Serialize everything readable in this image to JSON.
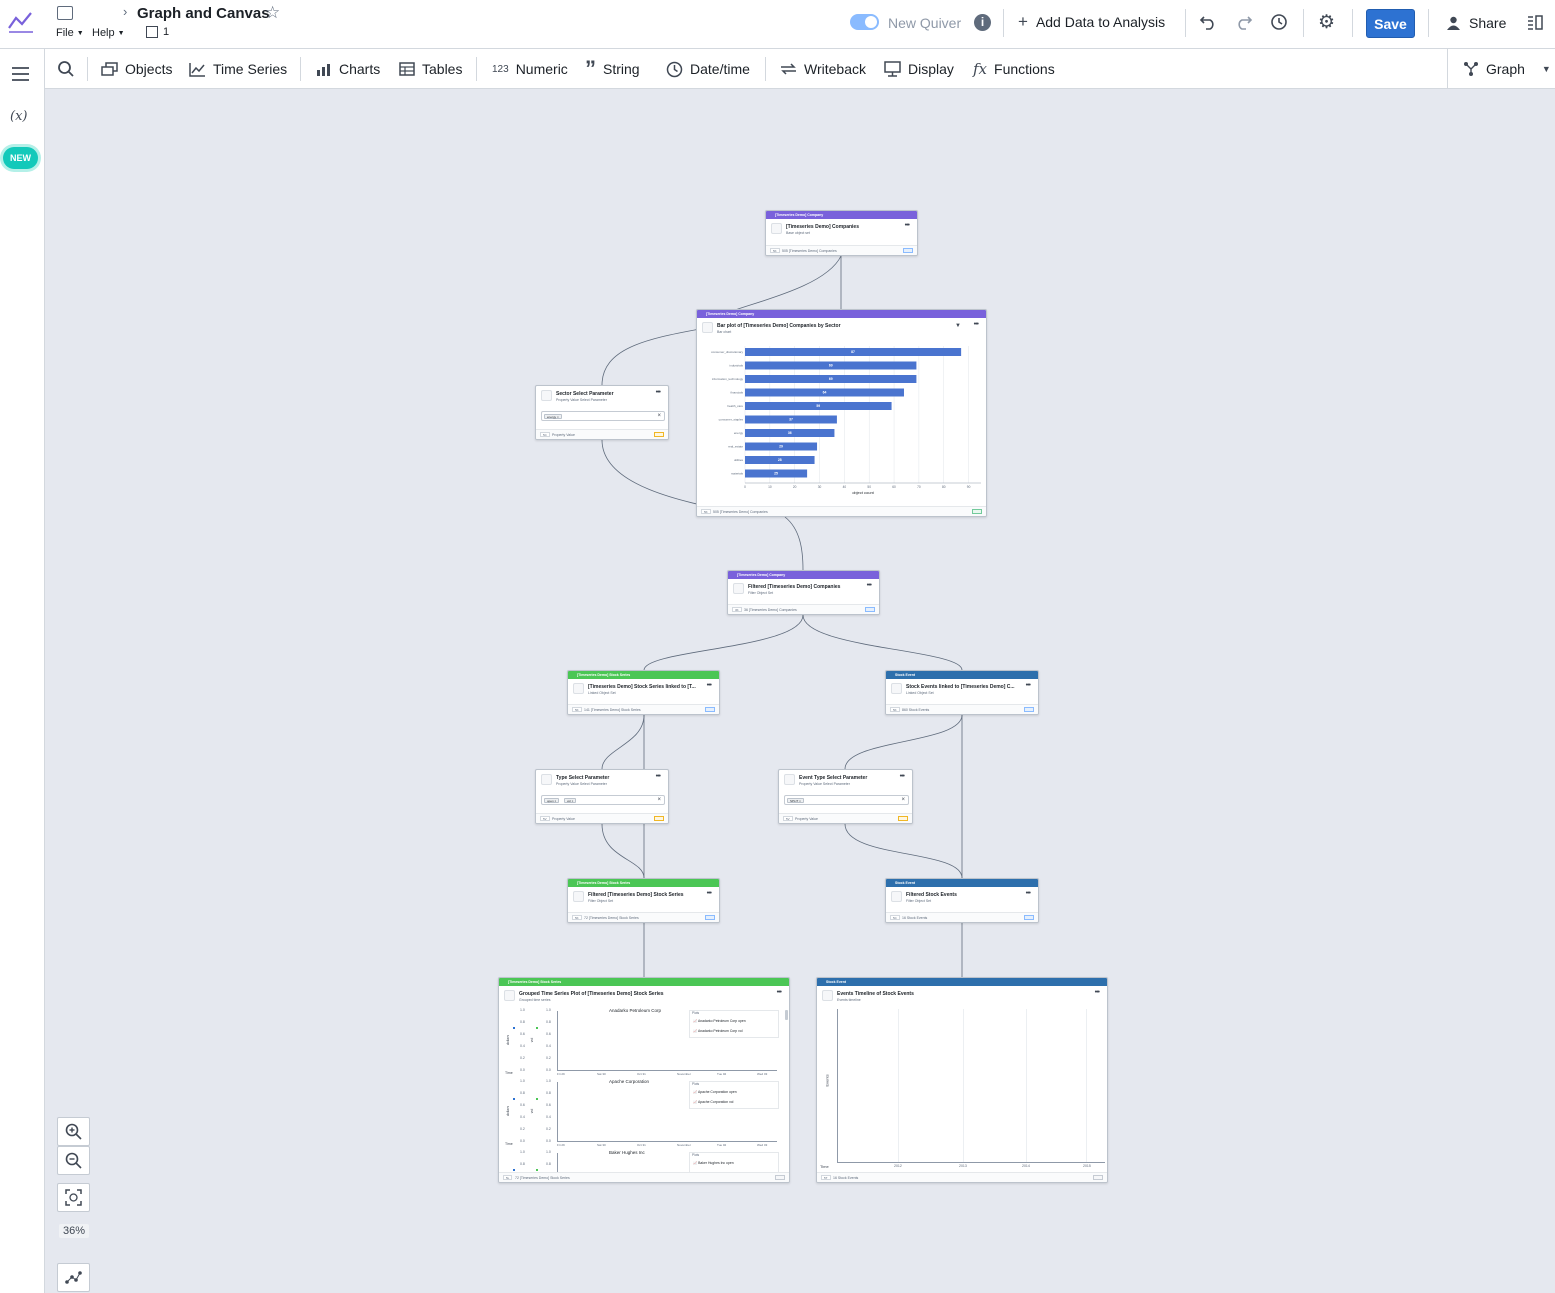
{
  "app": {
    "title": "Graph and Canvas",
    "menu_file": "File",
    "menu_help": "Help",
    "layer_count": "1"
  },
  "header": {
    "new_quiver_label": "New Quiver",
    "add_data_label": "Add Data to Analysis",
    "save_label": "Save",
    "share_label": "Share"
  },
  "toolbar": {
    "items": [
      "Objects",
      "Time Series",
      "Charts",
      "Tables",
      "Numeric",
      "String",
      "Date/time",
      "Writeback",
      "Display",
      "Functions"
    ],
    "numeric_prefix": "123",
    "view_label": "Graph"
  },
  "leftrail": {
    "variables_label": "(x)",
    "new_badge": "NEW"
  },
  "zoom": {
    "level": "36%"
  },
  "nodes": {
    "companies": {
      "type_label": "[Timeseries Demo] Company",
      "title": "[Timeseries Demo] Companies",
      "subtitle": "Base object set",
      "footer_count": "5K",
      "footer": "505 [Timeseries Demo] Companies"
    },
    "barplot": {
      "type_label": "[Timeseries Demo] Company",
      "title": "Bar plot of [Timeseries Demo] Companies by Sector",
      "subtitle": "Bar chart",
      "footer_count": "5K",
      "footer": "505 [Timeseries Demo] Companies"
    },
    "sector_param": {
      "title": "Sector Select Parameter",
      "subtitle": "Property Value Select Parameter",
      "chips": [
        "energy"
      ],
      "footer_count": "5C",
      "footer": "Property Value"
    },
    "filtered_companies": {
      "type_label": "[Timeseries Demo] Company",
      "title": "Filtered [Timeseries Demo] Companies",
      "subtitle": "Filter Object Set",
      "footer_count": "3K",
      "footer": "36 [Timeseries Demo] Companies"
    },
    "stock_series": {
      "type_label": "[Timeseries Demo] Stock Series",
      "title": "[Timeseries Demo] Stock Series linked to [T...",
      "subtitle": "Linked Object Set",
      "footer_count": "5K",
      "footer": "141 [Timeseries Demo] Stock Series"
    },
    "stock_events": {
      "type_label": "Stock Event",
      "title": "Stock Events linked to [Timeseries Demo] C...",
      "subtitle": "Linked Object Set",
      "footer_count": "5K",
      "footer": "860 Stock Events"
    },
    "type_param": {
      "title": "Type Select Parameter",
      "subtitle": "Property Value Select Parameter",
      "chips": [
        "open",
        "vol"
      ],
      "footer_count": "5V",
      "footer": "Property Value"
    },
    "event_type_param": {
      "title": "Event Type Select Parameter",
      "subtitle": "Property Value Select Parameter",
      "chips": [
        "SPLIT"
      ],
      "footer_count": "5V",
      "footer": "Property Value"
    },
    "filtered_series": {
      "type_label": "[Timeseries Demo] Stock Series",
      "title": "Filtered [Timeseries Demo] Stock Series",
      "subtitle": "Filter Object Set",
      "footer_count": "5K",
      "footer": "72 [Timeseries Demo] Stock Series"
    },
    "filtered_events": {
      "type_label": "Stock Event",
      "title": "Filtered Stock Events",
      "subtitle": "Filter Object Set",
      "footer_count": "5C",
      "footer": "16 Stock Events"
    },
    "grouped_ts": {
      "type_label": "[Timeseries Demo] Stock Series",
      "title": "Grouped Time Series Plot of [Timeseries Demo] Stock Series",
      "subtitle": "Grouped time series",
      "footer_count": "5L",
      "footer": "72 [Timeseries Demo] Stock Series"
    },
    "events_timeline": {
      "type_label": "Stock Event",
      "title": "Events Timeline of Stock Events",
      "subtitle": "Events timeline",
      "footer_count": "5T",
      "footer": "16 Stock Events",
      "y_label": "Events",
      "time_label": "Time",
      "ticks": [
        "2012",
        "2013",
        "2014",
        "2015"
      ]
    }
  },
  "grouped_ts_panels": [
    {
      "title": "Anadarko Petroleum Corp",
      "legend": [
        "Anadarko Petroleum Corp open",
        "Anadarko Petroleum Corp vol"
      ]
    },
    {
      "title": "Apache Corporation",
      "legend": [
        "Apache Corporation open",
        "Apache Corporation vol"
      ]
    },
    {
      "title": "Baker Hughes Inc",
      "legend": [
        "Baker Hughes Inc open"
      ]
    }
  ],
  "grouped_ts_axis": {
    "plots_label": "Plots",
    "time_label": "Time",
    "left_label": "dollars",
    "right_label": "vol",
    "x_ticks": [
      "Fri 29",
      "Sat 30",
      "Oct 31",
      "November",
      "Tue 02",
      "Wed 03"
    ],
    "y_ticks": [
      "1.0",
      "0.8",
      "0.6",
      "0.4",
      "0.2",
      "0.0"
    ]
  },
  "chart_data": {
    "type": "bar",
    "orientation": "horizontal",
    "categories": [
      "consumer_discretionary",
      "industrials",
      "information_technology",
      "financials",
      "health_care",
      "consumer_staples",
      "energy",
      "real_estate",
      "utilities",
      "materials"
    ],
    "values": [
      87,
      69,
      69,
      64,
      59,
      37,
      36,
      29,
      28,
      25
    ],
    "xlabel": "object count",
    "x_ticks": [
      "0",
      "10",
      "20",
      "30",
      "40",
      "50",
      "60",
      "70",
      "80",
      "90"
    ],
    "xlim": [
      0,
      95
    ],
    "color": "#4a74cf"
  },
  "colors": {
    "accent": "#2d72d2",
    "purple": "#7961db",
    "green": "#4bc655",
    "blue": "#2d6fac",
    "canvas": "#e5e8ef"
  }
}
